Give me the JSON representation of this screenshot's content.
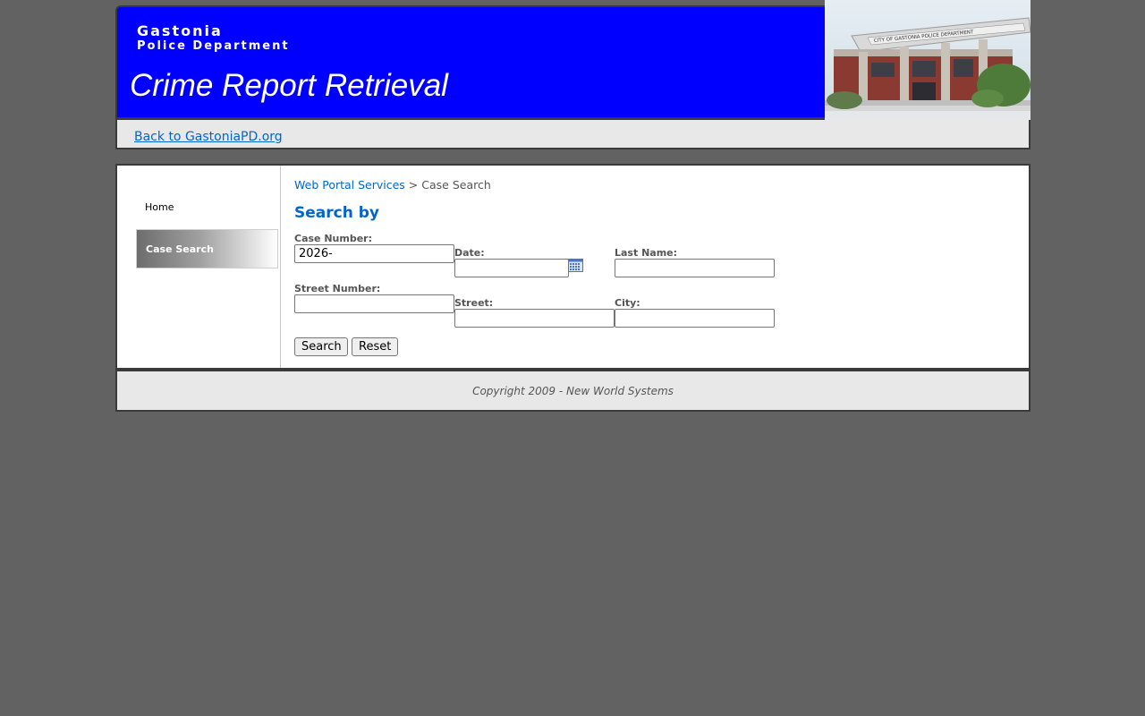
{
  "header": {
    "org_name": "Gastonia",
    "dept_name": "Police Department",
    "app_title": "Crime Report Retrieval",
    "accent_color": "#0000ff"
  },
  "building_photo": {
    "sign_text": "CITY OF GASTONIA POLICE DEPARTMENT"
  },
  "subbar": {
    "back_link": "Back to GastoniaPD.org"
  },
  "sidebar": {
    "items": [
      {
        "label": "Home",
        "active": false
      },
      {
        "label": "Case Search",
        "active": true
      }
    ]
  },
  "breadcrumb": {
    "link": "Web Portal Services",
    "separator": " > ",
    "current": "Case Search"
  },
  "form": {
    "heading": "Search by",
    "case_number": {
      "label": "Case Number:",
      "value": "2026-"
    },
    "date": {
      "label": "Date:",
      "value": ""
    },
    "last_name": {
      "label": "Last Name:",
      "value": ""
    },
    "street_number": {
      "label": "Street Number:",
      "value": ""
    },
    "street": {
      "label": "Street:",
      "value": ""
    },
    "city": {
      "label": "City:",
      "value": ""
    },
    "search_button": "Search",
    "reset_button": "Reset",
    "calendar_icon": "calendar-icon"
  },
  "footer": {
    "copyright": "Copyright 2009 - New World Systems"
  },
  "colors": {
    "page_bg": "#626262",
    "link": "#0066cc",
    "panel_bg": "#e8e8e8"
  }
}
